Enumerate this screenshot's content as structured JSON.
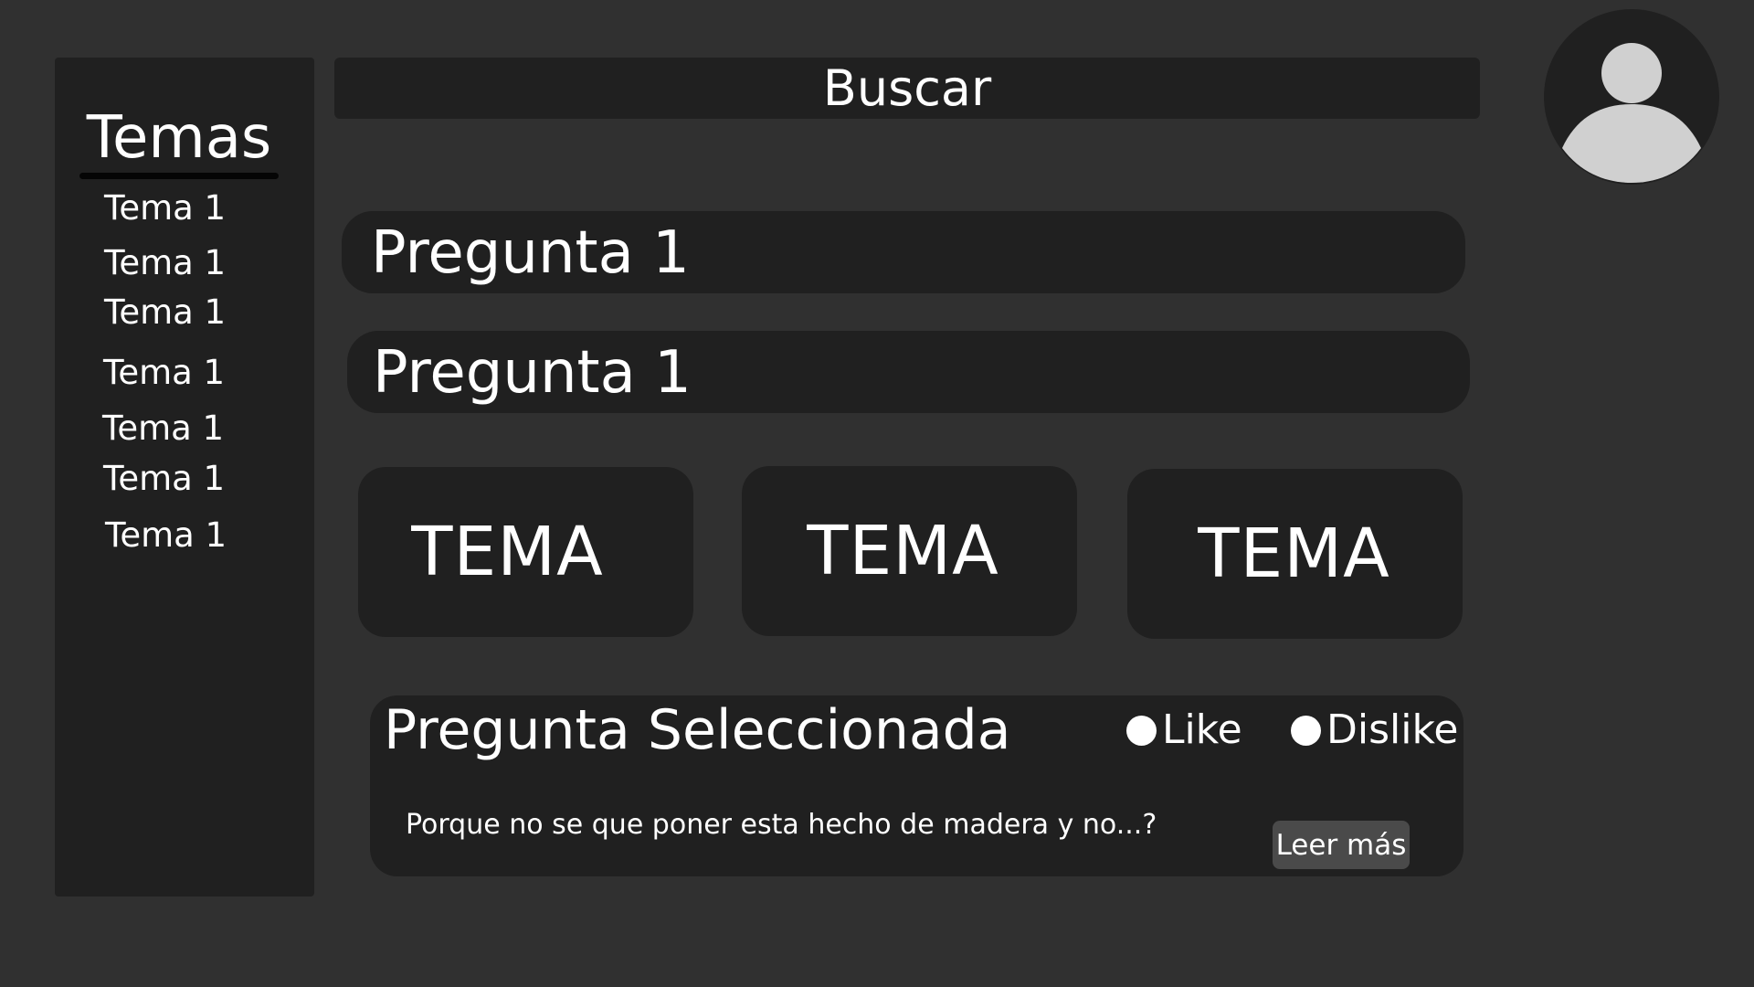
{
  "sidebar": {
    "title": "Temas",
    "items": [
      {
        "label": "Tema 1"
      },
      {
        "label": "Tema 1"
      },
      {
        "label": "Tema 1"
      },
      {
        "label": "Tema 1"
      },
      {
        "label": "Tema 1"
      },
      {
        "label": "Tema 1"
      },
      {
        "label": "Tema 1"
      }
    ]
  },
  "search": {
    "label": "Buscar"
  },
  "avatar": {
    "icon": "user-avatar-icon"
  },
  "questions": [
    {
      "label": "Pregunta 1"
    },
    {
      "label": "Pregunta 1"
    }
  ],
  "topic_cards": [
    {
      "label": "TEMA"
    },
    {
      "label": "TEMA"
    },
    {
      "label": "TEMA"
    }
  ],
  "selected_question": {
    "title": "Pregunta Seleccionada",
    "like_label": "Like",
    "dislike_label": "Dislike",
    "body": "Porque no se que poner esta hecho de madera y no...?",
    "read_more_label": "Leer más"
  },
  "colors": {
    "background": "#303030",
    "panel": "#202020",
    "text": "#ffffff",
    "button": "#4a4a4a",
    "avatar_figure": "#d0d0d0"
  }
}
